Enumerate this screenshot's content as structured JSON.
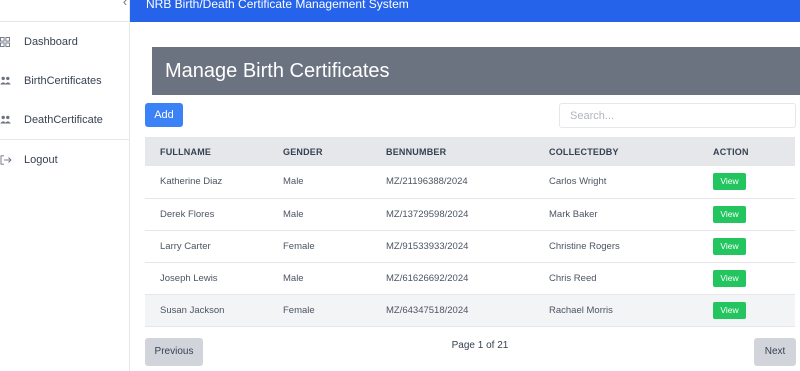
{
  "app": {
    "title": "NRB Birth/Death Certificate Management System"
  },
  "sidebar": {
    "toggle": "‹",
    "items": [
      {
        "label": "Dashboard",
        "icon": "dashboard-icon"
      },
      {
        "label": "BirthCertificates",
        "icon": "users-icon"
      },
      {
        "label": "DeathCertificate",
        "icon": "users-icon"
      }
    ],
    "logout": {
      "label": "Logout",
      "icon": "logout-icon"
    }
  },
  "page": {
    "title": "Manage Birth Certificates",
    "add_label": "Add",
    "search_placeholder": "Search..."
  },
  "table": {
    "headers": [
      "FULLNAME",
      "GENDER",
      "BENNUMBER",
      "COLLECTEDBY",
      "ACTION"
    ],
    "rows": [
      {
        "fullname": "Katherine Diaz",
        "gender": "Male",
        "bennumber": "MZ/21196388/2024",
        "collectedby": "Carlos Wright",
        "action": "View"
      },
      {
        "fullname": "Derek Flores",
        "gender": "Male",
        "bennumber": "MZ/13729598/2024",
        "collectedby": "Mark Baker",
        "action": "View"
      },
      {
        "fullname": "Larry Carter",
        "gender": "Female",
        "bennumber": "MZ/91533933/2024",
        "collectedby": "Christine Rogers",
        "action": "View"
      },
      {
        "fullname": "Joseph Lewis",
        "gender": "Male",
        "bennumber": "MZ/61626692/2024",
        "collectedby": "Chris Reed",
        "action": "View"
      },
      {
        "fullname": "Susan Jackson",
        "gender": "Female",
        "bennumber": "MZ/64347518/2024",
        "collectedby": "Rachael Morris",
        "action": "View"
      }
    ]
  },
  "pagination": {
    "previous": "Previous",
    "info": "Page 1 of 21",
    "next": "Next"
  },
  "colors": {
    "topbar": "#2563eb",
    "title_box": "#6b7280",
    "add_button": "#3b82f6",
    "view_button": "#22c55e"
  }
}
